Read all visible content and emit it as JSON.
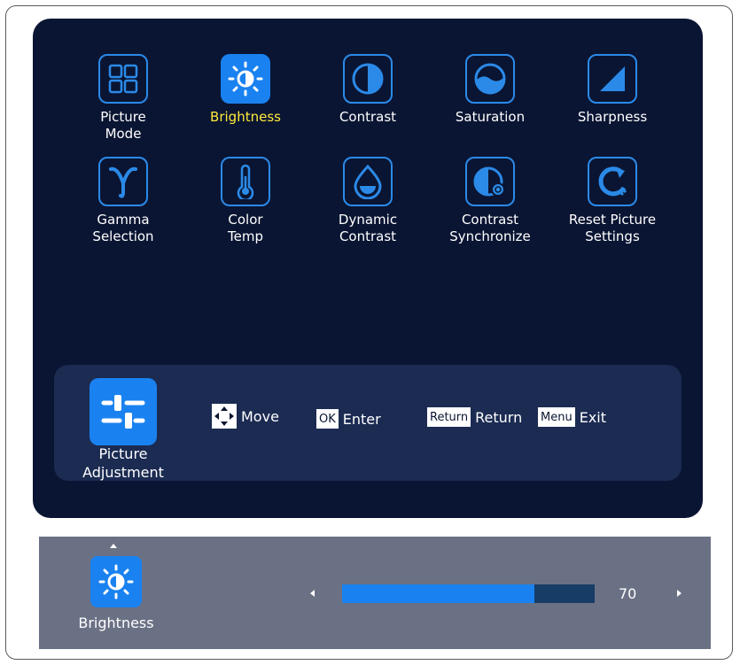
{
  "osd": {
    "tiles": [
      {
        "label": "Picture\nMode",
        "icon": "grid-icon",
        "selected": false
      },
      {
        "label": "Brightness",
        "icon": "sun-icon",
        "selected": true
      },
      {
        "label": "Contrast",
        "icon": "contrast-icon",
        "selected": false
      },
      {
        "label": "Saturation",
        "icon": "saturation-icon",
        "selected": false
      },
      {
        "label": "Sharpness",
        "icon": "sharpness-icon",
        "selected": false
      },
      {
        "label": "Gamma\nSelection",
        "icon": "gamma-icon",
        "selected": false
      },
      {
        "label": "Color\nTemp",
        "icon": "thermometer-icon",
        "selected": false
      },
      {
        "label": "Dynamic\nContrast",
        "icon": "droplet-icon",
        "selected": false
      },
      {
        "label": "Contrast\nSynchronize",
        "icon": "contrast-sync-icon",
        "selected": false
      },
      {
        "label": "Reset Picture\nSettings",
        "icon": "reset-icon",
        "selected": false
      }
    ],
    "help": {
      "category_label": "Picture\nAdjustment",
      "move_label": "Move",
      "ok_key": "OK",
      "enter_label": "Enter",
      "return_key": "Return",
      "return_label": "Return",
      "menu_key": "Menu",
      "exit_label": "Exit"
    },
    "colors": {
      "accent": "#1a82f0",
      "panel": "#0a1533",
      "highlight": "#ffeb3b"
    }
  },
  "slider": {
    "label": "Brightness",
    "value": "70",
    "fill_percent": 76
  }
}
